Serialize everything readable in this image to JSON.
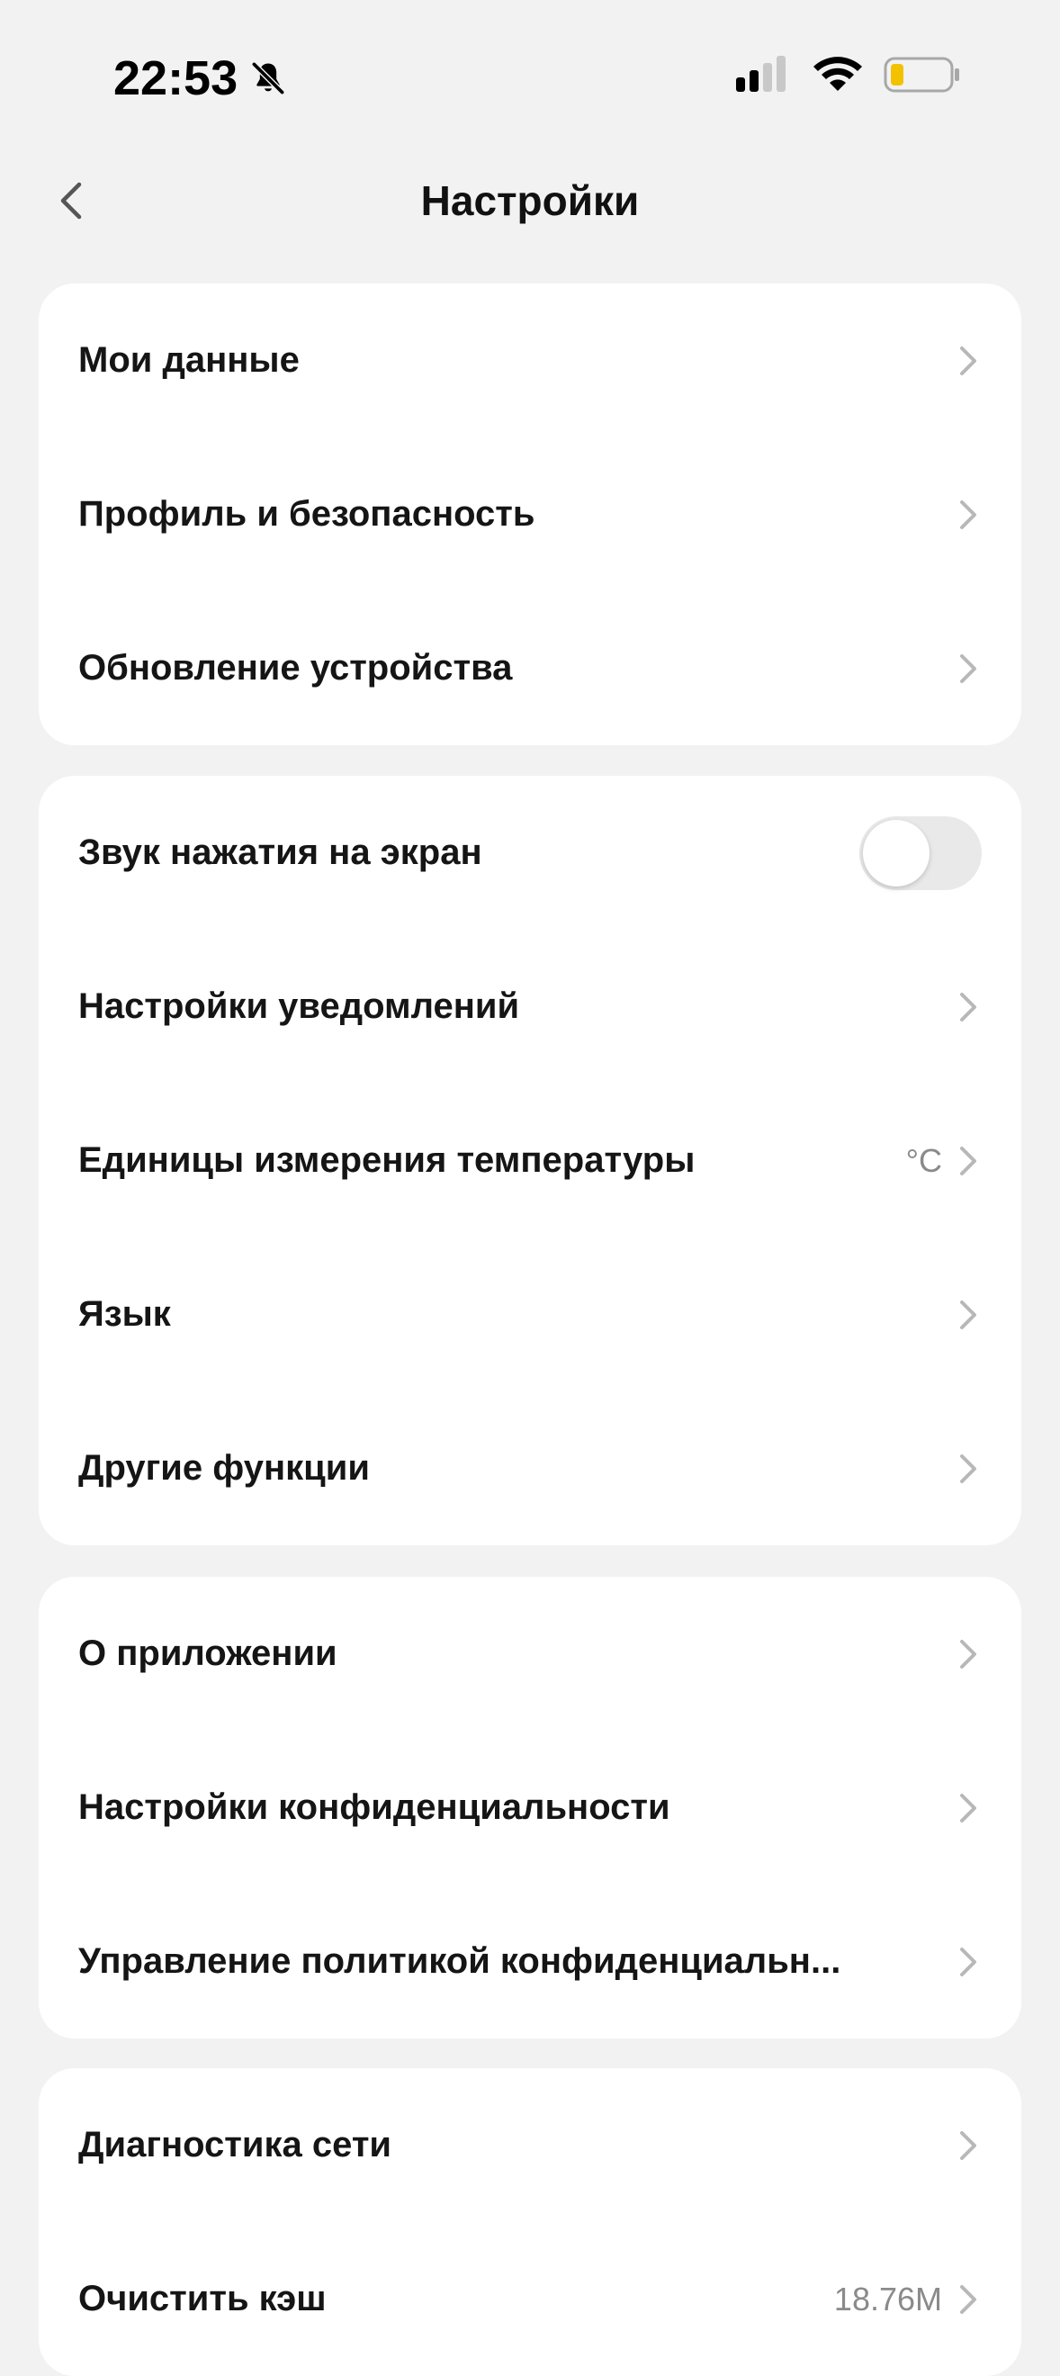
{
  "status_bar": {
    "time": "22:53",
    "icons": [
      "bell-off-icon",
      "cellular-signal-icon",
      "wifi-icon",
      "battery-low-icon"
    ],
    "battery_color": "#f2c200"
  },
  "header": {
    "title": "Настройки",
    "back_icon": "chevron-left-icon"
  },
  "groups": [
    {
      "items": [
        {
          "label": "Мои данные"
        },
        {
          "label": "Профиль и безопасность"
        },
        {
          "label": "Обновление устройства"
        }
      ]
    },
    {
      "items": [
        {
          "label": "Звук нажатия на экран",
          "toggle": false
        },
        {
          "label": "Настройки уведомлений"
        },
        {
          "label": "Единицы измерения температуры",
          "value": "°C"
        },
        {
          "label": "Язык"
        },
        {
          "label": "Другие функции"
        }
      ]
    },
    {
      "items": [
        {
          "label": "О приложении"
        },
        {
          "label": "Настройки конфиденциальности"
        },
        {
          "label": "Управление политикой конфиденциальн..."
        }
      ]
    },
    {
      "items": [
        {
          "label": "Диагностика сети"
        },
        {
          "label": "Очистить кэш",
          "value": "18.76M"
        }
      ]
    }
  ],
  "colors": {
    "background": "#f2f2f2",
    "card": "#ffffff",
    "text": "#151515",
    "secondary": "#8a8a8a",
    "chevron": "#b8b8b8",
    "toggle_off": "#e9e9e9"
  }
}
